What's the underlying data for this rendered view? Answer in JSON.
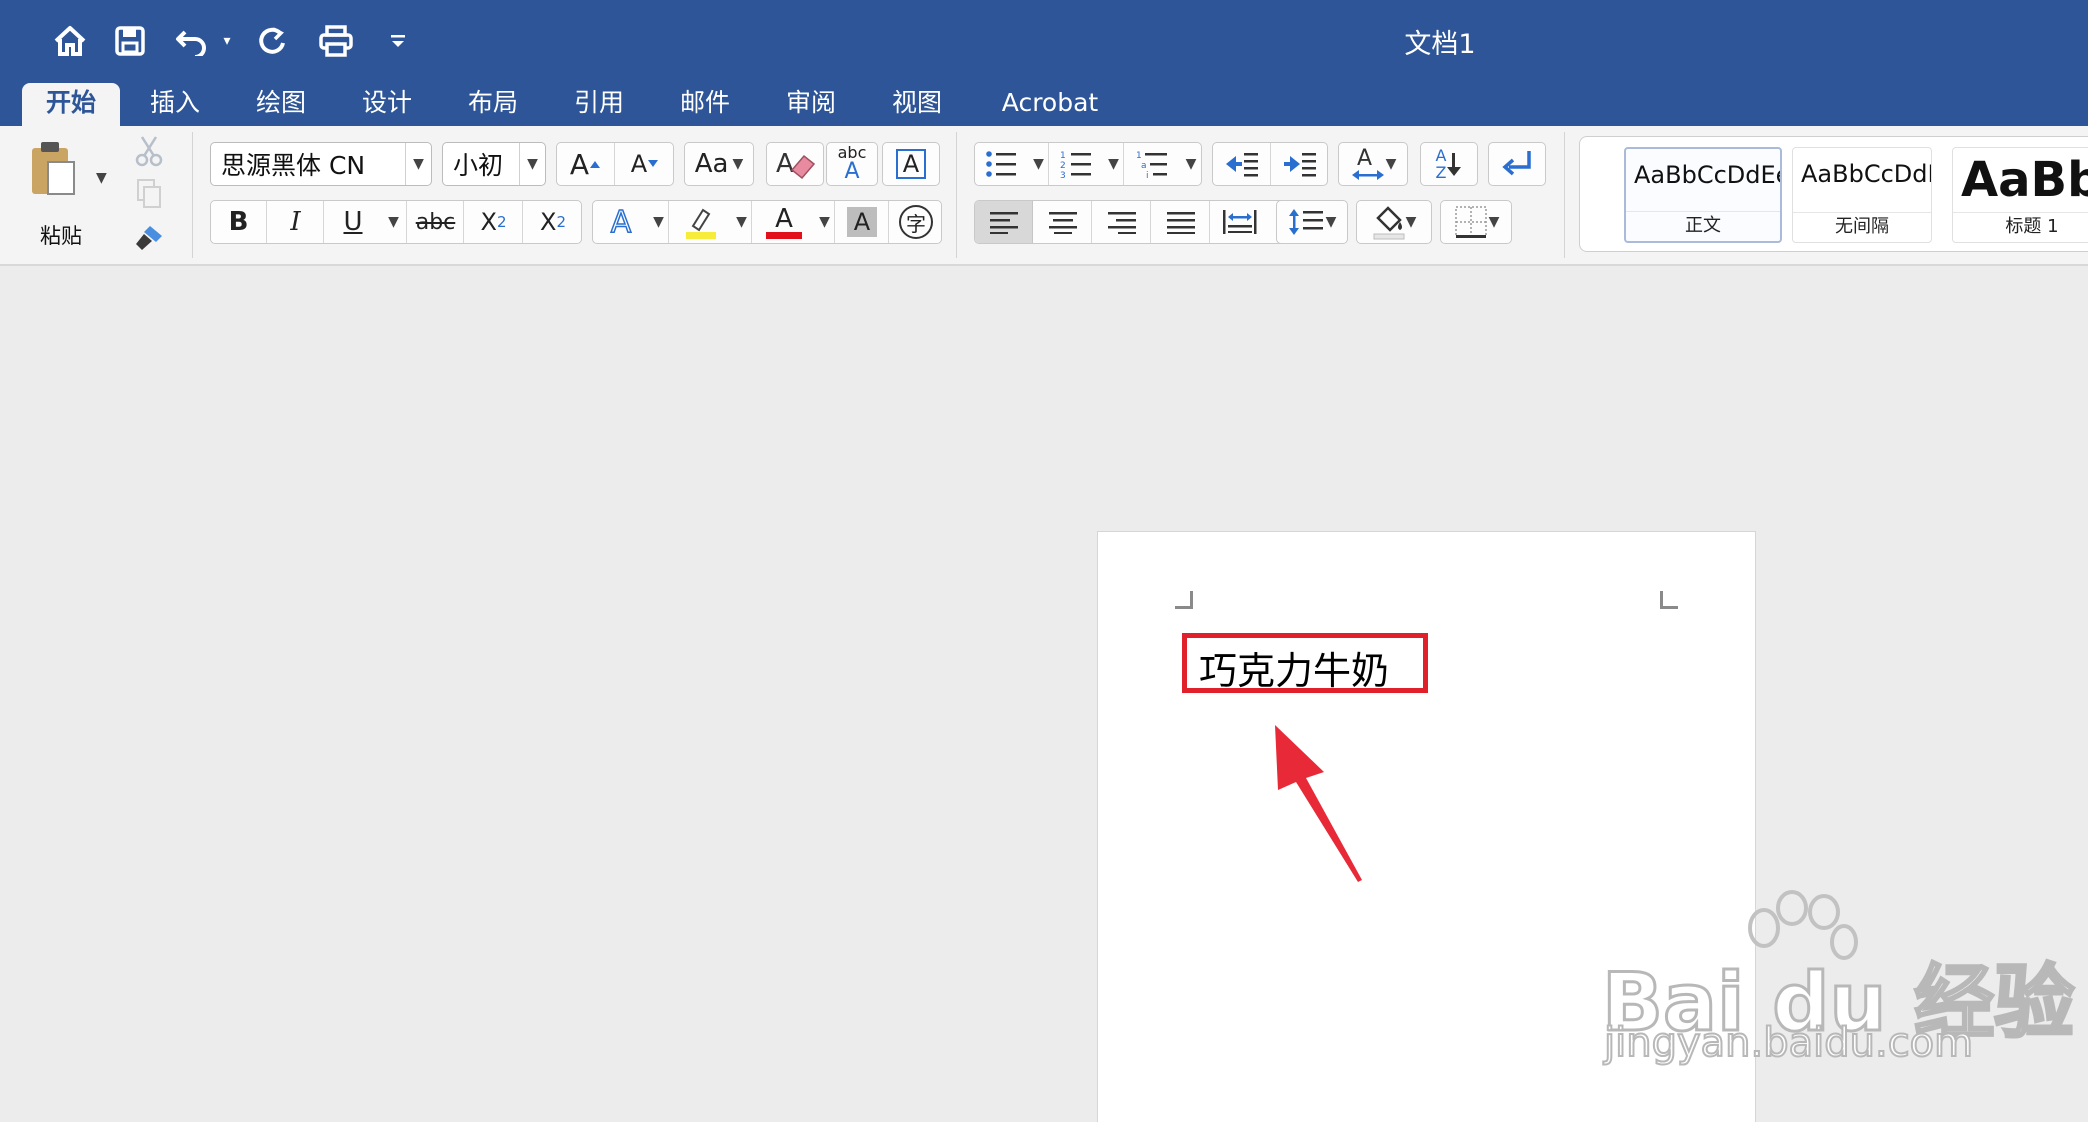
{
  "window": {
    "title": "文档1"
  },
  "quick_access": {
    "icons": [
      "home-icon",
      "save-icon",
      "undo-icon",
      "redo-icon",
      "print-icon",
      "customize-icon"
    ]
  },
  "tabs": [
    {
      "label": "开始",
      "active": true
    },
    {
      "label": "插入"
    },
    {
      "label": "绘图"
    },
    {
      "label": "设计"
    },
    {
      "label": "布局"
    },
    {
      "label": "引用"
    },
    {
      "label": "邮件"
    },
    {
      "label": "审阅"
    },
    {
      "label": "视图"
    },
    {
      "label": "Acrobat"
    }
  ],
  "ribbon": {
    "paste_label": "粘贴",
    "font_name": "思源黑体 CN",
    "font_size": "小初",
    "bold": "B",
    "italic": "I",
    "underline": "U",
    "strike": "abc",
    "subscript_base": "X",
    "subscript_mark": "2",
    "superscript_base": "X",
    "superscript_mark": "2",
    "grow_font": "A",
    "shrink_font": "A",
    "change_case": "Aa",
    "phonetic_top": "abc",
    "phonetic_bottom": "A",
    "char_border": "A",
    "text_effects": "A",
    "font_color": "A",
    "char_shading": "A",
    "enclose_char": "字",
    "sort_top": "A",
    "sort_bottom": "Z",
    "font_color_hex": "#e2101a",
    "highlight_hex": "#f8ec3a"
  },
  "styles": [
    {
      "sample": "AaBbCcDdEe",
      "name": "正文",
      "active": true
    },
    {
      "sample": "AaBbCcDdEe",
      "name": "无间隔"
    },
    {
      "sample": "AaBbC",
      "name": "标题 1"
    }
  ],
  "document": {
    "text": "巧克力牛奶",
    "annotation_color": "#e0202a"
  },
  "watermark": {
    "main": "Bai du 经验",
    "sub": "jingyan.baidu.com"
  }
}
